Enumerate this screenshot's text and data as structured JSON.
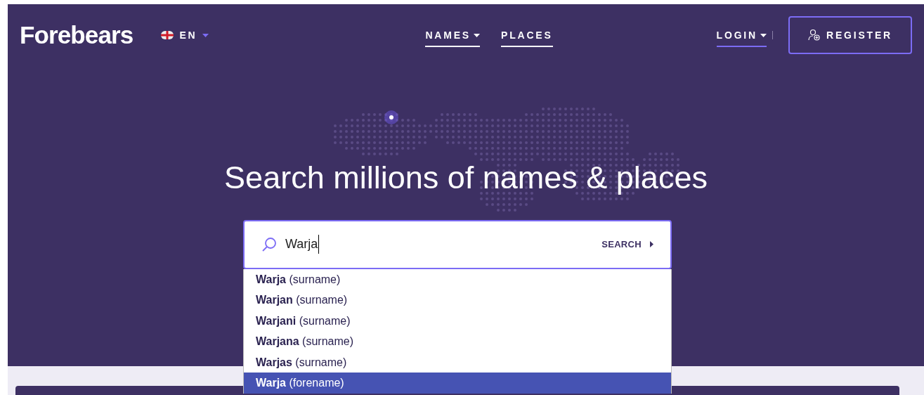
{
  "logo": "Forebears",
  "language": {
    "code": "EN"
  },
  "nav": [
    {
      "label": "NAMES",
      "dropdown": true
    },
    {
      "label": "PLACES",
      "dropdown": false
    }
  ],
  "login": {
    "label": "LOGIN"
  },
  "register": {
    "label": "REGISTER"
  },
  "headline": "Search millions of names & places",
  "search": {
    "value": "Warja",
    "button": "SEARCH"
  },
  "suggestions": [
    {
      "text": "**Warja** (surname)",
      "selected": false
    },
    {
      "text": "**Warjan** (surname)",
      "selected": false
    },
    {
      "text": "**Warjani** (surname)",
      "selected": false
    },
    {
      "text": "**Warjana** (surname)",
      "selected": false
    },
    {
      "text": "**Warjas** (surname)",
      "selected": false
    },
    {
      "text": "**Warja** (forename)",
      "selected": true
    }
  ]
}
